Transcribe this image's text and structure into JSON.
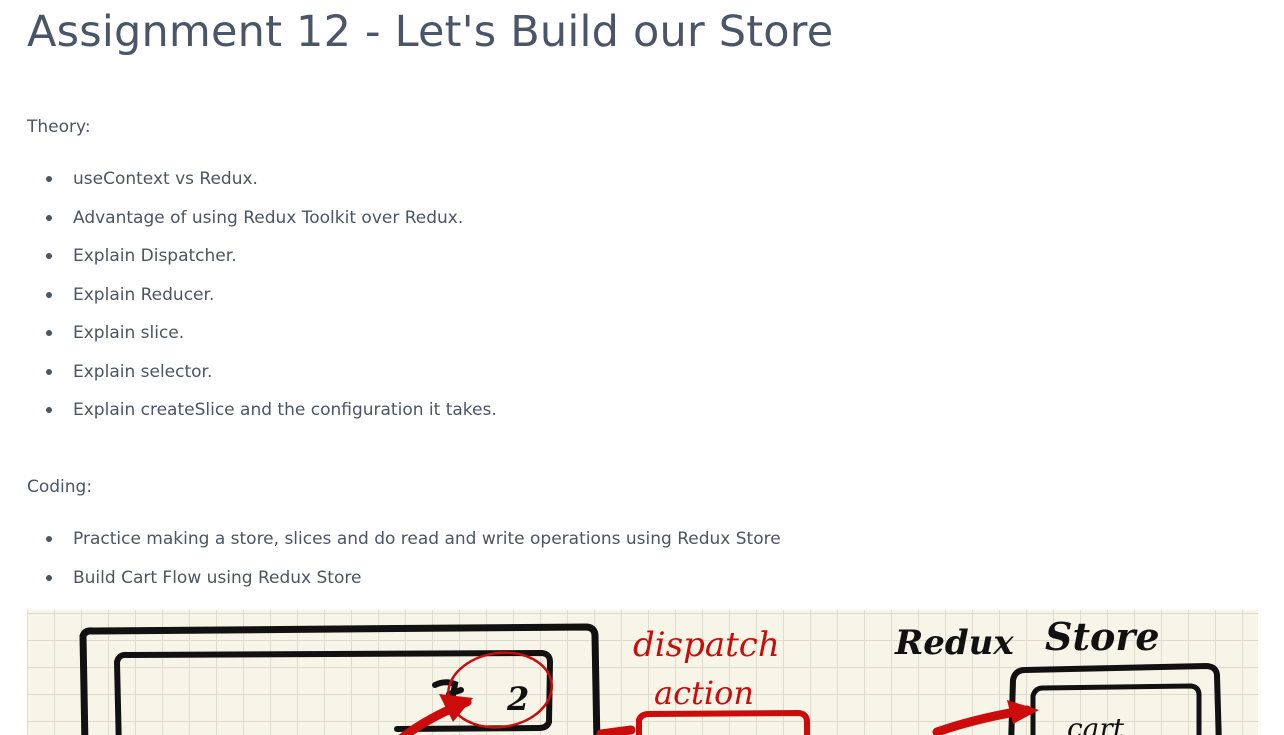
{
  "page": {
    "title": "Assignment 12 - Let's Build our Store"
  },
  "theory": {
    "label": "Theory:",
    "items": [
      "useContext vs Redux.",
      "Advantage of using Redux Toolkit over Redux.",
      "Explain Dispatcher.",
      "Explain Reducer.",
      "Explain slice.",
      "Explain selector.",
      "Explain createSlice and the configuration it takes."
    ]
  },
  "coding": {
    "label": "Coding:",
    "items": [
      "Practice making a store, slices and do read and write operations using Redux Store",
      "Build Cart Flow using Redux Store"
    ]
  },
  "diagram": {
    "dispatch_label": "dispatch",
    "action_label": "action",
    "redux_label": "Redux",
    "store_label": "Store",
    "count_label": "2",
    "cart_label": "cart",
    "colors": {
      "ink": "#111111",
      "marker_red": "#cc0b0b",
      "paper": "#f7f4e8",
      "grid": "#dedbcc"
    }
  }
}
